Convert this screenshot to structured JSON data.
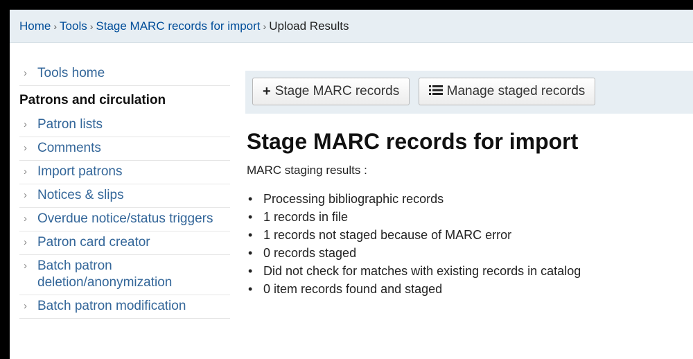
{
  "breadcrumb": {
    "items": [
      "Home",
      "Tools",
      "Stage MARC records for import"
    ],
    "current": "Upload Results",
    "separator": "›"
  },
  "sidebar": {
    "tools_home": "Tools home",
    "section_heading": "Patrons and circulation",
    "items": [
      "Patron lists",
      "Comments",
      "Import patrons",
      "Notices & slips",
      "Overdue notice/status triggers",
      "Patron card creator",
      "Batch patron deletion/anonymization",
      "Batch patron modification"
    ]
  },
  "toolbar": {
    "stage_button": "Stage MARC records",
    "manage_button": "Manage staged records"
  },
  "main": {
    "title": "Stage MARC records for import",
    "subtitle": "MARC staging results :",
    "results": [
      "Processing bibliographic records",
      "1 records in file",
      "1 records not staged because of MARC error",
      "0 records staged",
      "Did not check for matches with existing records in catalog",
      "0 item records found and staged"
    ]
  },
  "colors": {
    "link": "#336699",
    "toolbar_bg": "#e7eef3"
  }
}
